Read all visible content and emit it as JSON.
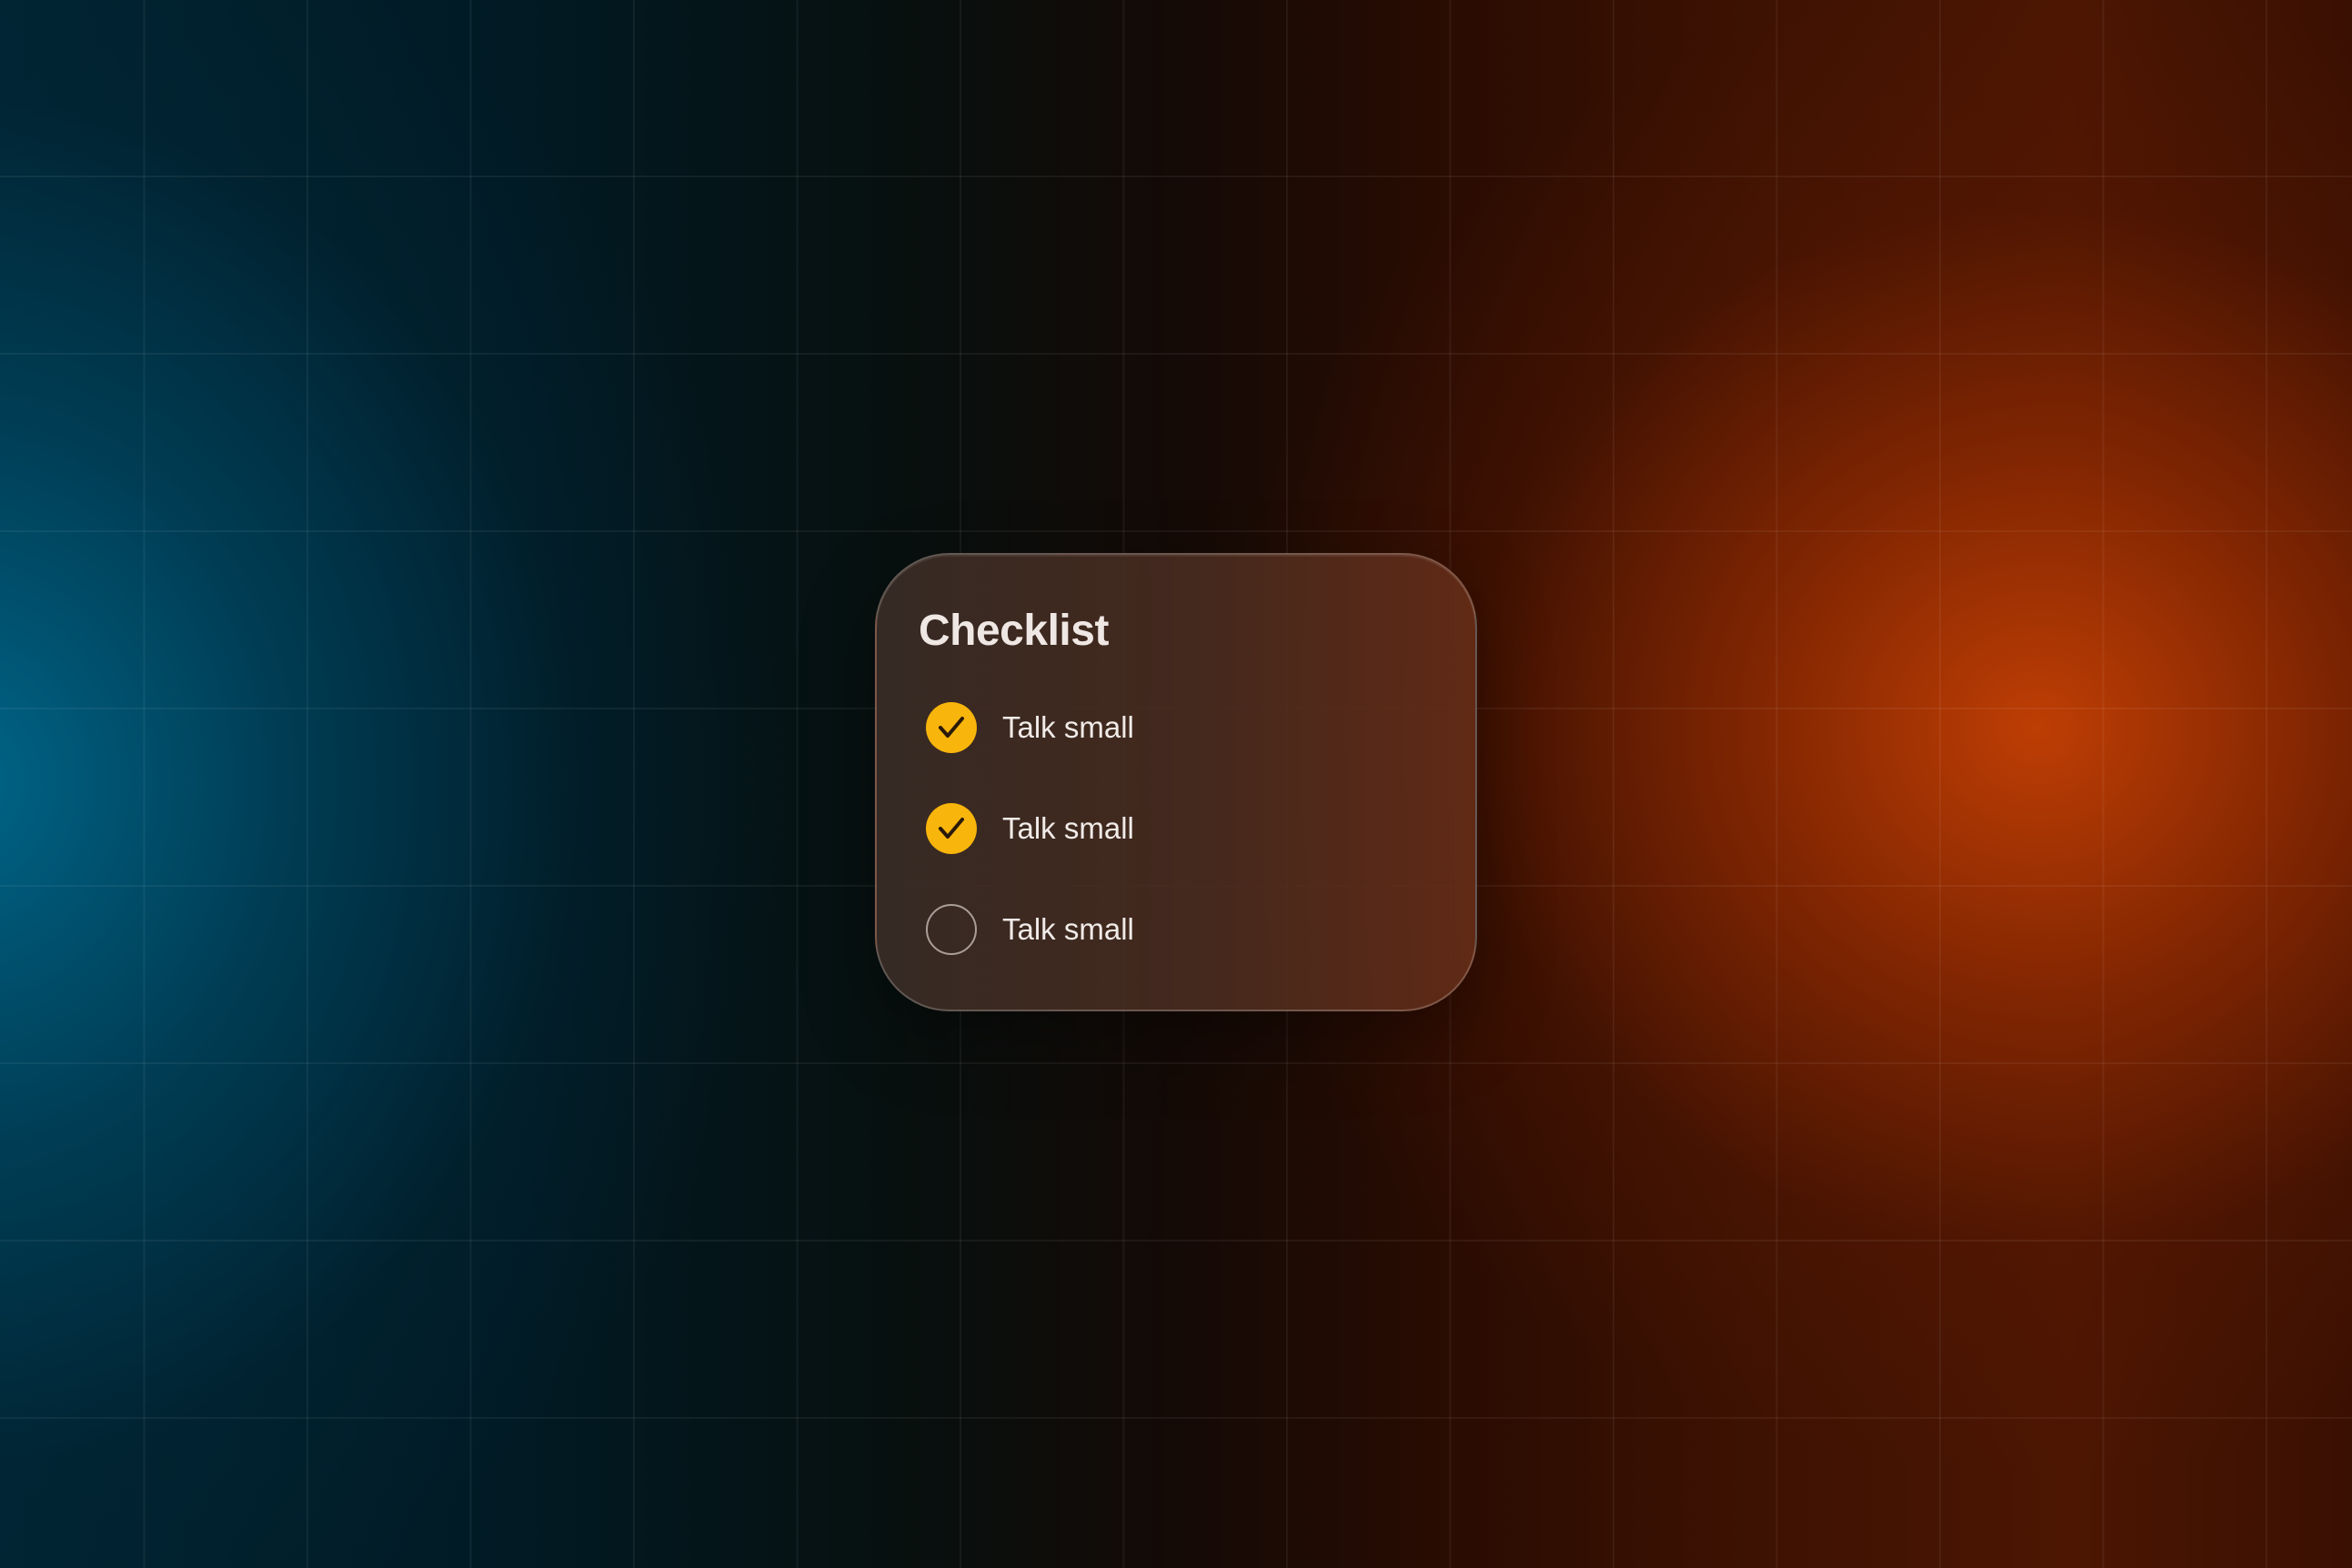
{
  "background": {
    "left_glow_color": "#00688c",
    "right_glow_color": "#c44004",
    "grid_visible": true
  },
  "checklist": {
    "title": "Checklist",
    "check_color": "#f8b50b",
    "items": [
      {
        "label": "Talk small",
        "checked": true
      },
      {
        "label": "Talk small",
        "checked": true
      },
      {
        "label": "Talk small",
        "checked": false
      }
    ]
  }
}
